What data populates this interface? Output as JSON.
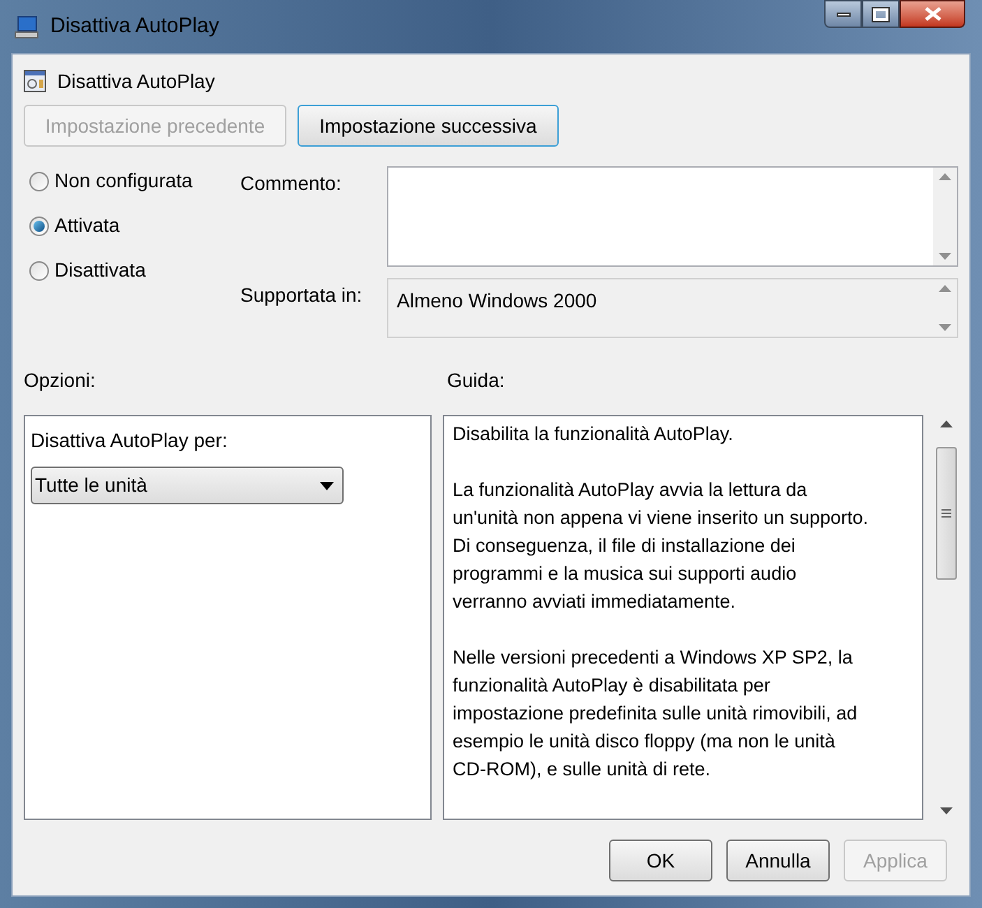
{
  "window": {
    "title": "Disattiva AutoPlay"
  },
  "setting_title": "Disattiva AutoPlay",
  "nav_buttons": [
    {
      "label": "Impostazione precedente",
      "disabled": true
    },
    {
      "label": "Impostazione successiva",
      "disabled": false
    }
  ],
  "radios": [
    {
      "label": "Non configurata",
      "selected": false
    },
    {
      "label": "Attivata",
      "selected": true
    },
    {
      "label": "Disattivata",
      "selected": false
    }
  ],
  "comment": {
    "label": "Commento:"
  },
  "supported": {
    "label": "Supportata in:",
    "value": "Almeno Windows 2000"
  },
  "options": {
    "label": "Opzioni:",
    "field_label": "Disattiva AutoPlay per:",
    "dropdown_value": "Tutte le unità"
  },
  "help": {
    "label": "Guida:",
    "paragraphs": [
      [
        "Disabilita la funzionalità AutoPlay."
      ],
      [
        "La funzionalità AutoPlay avvia la lettura da",
        "un'unità non appena vi viene inserito un supporto.",
        "Di conseguenza, il file di installazione dei",
        "programmi e la musica sui supporti audio",
        "verranno avviati immediatamente."
      ],
      [
        "Nelle versioni precedenti a Windows XP SP2, la",
        "funzionalità AutoPlay è disabilitata per",
        "impostazione predefinita sulle unità rimovibili, ad",
        "esempio le unità disco floppy (ma non le unità",
        "CD-ROM), e sulle unità di rete."
      ]
    ]
  },
  "buttons": [
    {
      "label": "OK",
      "disabled": false
    },
    {
      "label": "Annulla",
      "disabled": false
    },
    {
      "label": "Applica",
      "disabled": true
    }
  ]
}
